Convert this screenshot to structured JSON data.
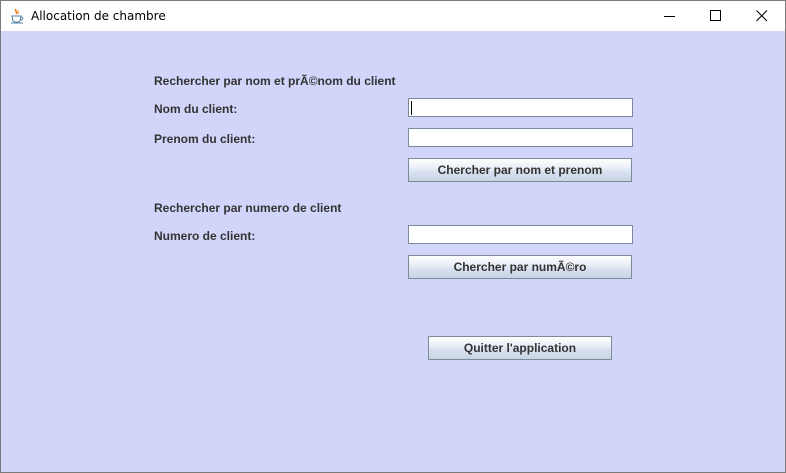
{
  "window": {
    "title": "Allocation de chambre"
  },
  "search_by_name": {
    "heading": "Rechercher par nom et prÃ©nom du client",
    "lastname_label": "Nom du client:",
    "lastname_value": "",
    "firstname_label": "Prenom du client:",
    "firstname_value": "",
    "button_label": "Chercher par nom et prenom"
  },
  "search_by_number": {
    "heading": "Rechercher par numero de client",
    "number_label": "Numero de client:",
    "number_value": "",
    "button_label": "Chercher par numÃ©ro"
  },
  "quit_button_label": "Quitter l'application",
  "colors": {
    "content_background": "#d1d5fa",
    "label_text": "#333333",
    "field_border": "#7a8a99"
  },
  "icons": {
    "app": "java-cup-icon",
    "minimize": "minimize-icon",
    "maximize": "maximize-icon",
    "close": "close-icon"
  }
}
